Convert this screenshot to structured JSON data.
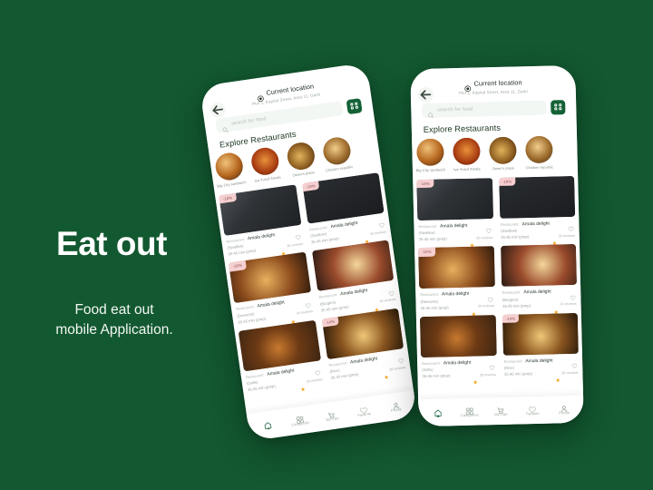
{
  "theme": {
    "background": "#125830",
    "accent": "#146236",
    "badge_bg": "#f6cfd0",
    "badge_text": "#8d5356",
    "star": "#f5a623"
  },
  "marketing": {
    "title": "Eat out",
    "subtitle": "Food eat out\nmobile Application."
  },
  "app": {
    "header": {
      "back_icon": "arrow-left-icon",
      "location_icon": "location-pin-icon",
      "location_title": "Current location",
      "location_address": "Plot 1, Kapital Street, Area 11, Garki",
      "qr_icon": "qr-scan-icon"
    },
    "search": {
      "icon": "search-icon",
      "placeholder": "search for food",
      "value": ""
    },
    "section_title": "Explore Restaurants",
    "restaurants": [
      {
        "name": "Big City sandwich",
        "image": "burger-photo"
      },
      {
        "name": "Iya Yusuf Amala",
        "image": "jollof-photo"
      },
      {
        "name": "Owen's place",
        "image": "fried-chicken-photo"
      },
      {
        "name": "Chicken republic",
        "image": "chicken-burger-photo"
      }
    ],
    "cards": [
      {
        "badge": "-18%",
        "label": "Restaurant:",
        "restaurant": "Amala delight",
        "category": "(Swallow)",
        "time": "35-45 min (prep)",
        "reviews": "30 reviews",
        "image": "stew-bowl-photo",
        "favorite_icon": "heart-icon",
        "star_icon": "star-icon"
      },
      {
        "badge": "-18%",
        "label": "Restaurant:",
        "restaurant": "Amala delight",
        "category": "(Swallow)",
        "time": "35-45 min (prep)",
        "reviews": "30 reviews",
        "image": "pasta-bowl-photo",
        "favorite_icon": "heart-icon",
        "star_icon": "star-icon"
      },
      {
        "badge": "-16%",
        "label": "Restaurant:",
        "restaurant": "Amala delight",
        "category": "(Desserts)",
        "time": "35-45 min (prep)",
        "reviews": "34 reviews",
        "image": "roast-platter-photo",
        "favorite_icon": "heart-icon",
        "star_icon": "star-icon"
      },
      {
        "badge": "",
        "label": "Restaurant:",
        "restaurant": "Amala delight",
        "category": "(Burgers)",
        "time": "35-45 min (prep)",
        "reviews": "34 reviews",
        "image": "burger-closeup-photo",
        "favorite_icon": "heart-icon",
        "star_icon": "star-icon"
      },
      {
        "badge": "",
        "label": "Restaurant:",
        "restaurant": "Amala delight",
        "category": "(Grills)",
        "time": "35-45 min (prep)",
        "reviews": "28 reviews",
        "image": "skillet-photo",
        "favorite_icon": "heart-icon",
        "star_icon": "star-icon"
      },
      {
        "badge": "-14%",
        "label": "Restaurant:",
        "restaurant": "Amala delight",
        "category": "(Rice)",
        "time": "35-45 min (prep)",
        "reviews": "28 reviews",
        "image": "roast-rice-photo",
        "favorite_icon": "heart-icon",
        "star_icon": "star-icon"
      }
    ],
    "bottom_nav": [
      {
        "label": "",
        "icon": "home-icon",
        "active": true
      },
      {
        "label": "Categories",
        "icon": "grid-icon",
        "active": false
      },
      {
        "label": "My Cart",
        "icon": "cart-icon",
        "active": false
      },
      {
        "label": "Favorite",
        "icon": "heart-icon",
        "active": false
      },
      {
        "label": "Profile",
        "icon": "user-icon",
        "active": false
      }
    ]
  }
}
